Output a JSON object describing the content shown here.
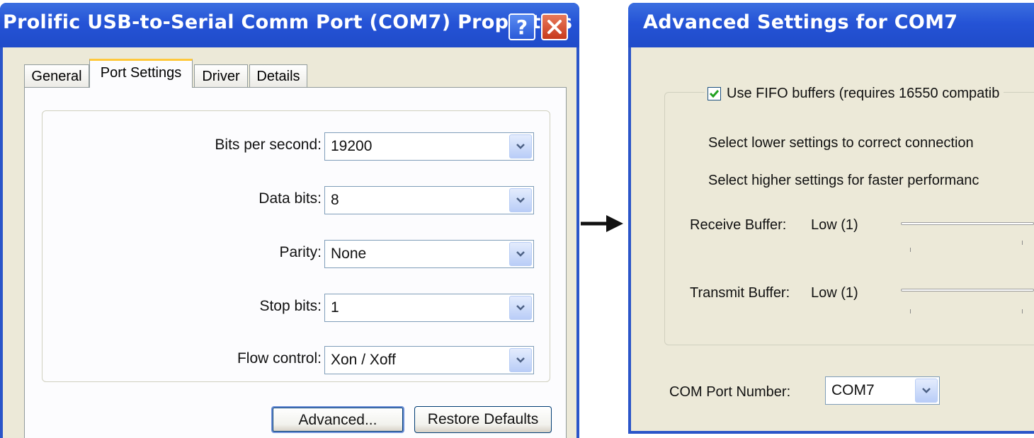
{
  "left_dialog": {
    "title": "Prolific USB-to-Serial Comm Port (COM7) Properties",
    "help_label": "?",
    "tabs": [
      {
        "label": "General"
      },
      {
        "label": "Port Settings"
      },
      {
        "label": "Driver"
      },
      {
        "label": "Details"
      }
    ],
    "fields": {
      "bits": {
        "label": "Bits per second:",
        "value": "19200"
      },
      "data_bits": {
        "label": "Data bits:",
        "value": "8"
      },
      "parity": {
        "label": "Parity:",
        "value": "None"
      },
      "stop_bits": {
        "label": "Stop bits:",
        "value": "1"
      },
      "flow": {
        "label": "Flow control:",
        "value": "Xon / Xoff"
      }
    },
    "buttons": {
      "advanced": "Advanced...",
      "restore": "Restore Defaults"
    }
  },
  "right_dialog": {
    "title": "Advanced Settings for COM7",
    "fifo_label": "Use FIFO buffers (requires 16550 compatib",
    "fifo_checked": true,
    "hint_lower": "Select lower settings to correct connection",
    "hint_higher": "Select higher settings for faster performanc",
    "receive": {
      "label": "Receive Buffer:",
      "value": "Low (1)"
    },
    "transmit": {
      "label": "Transmit Buffer:",
      "value": "Low (1)"
    },
    "com_port": {
      "label": "COM Port Number:",
      "value": "COM7"
    }
  },
  "colors": {
    "title_bar": "#2553d6",
    "dialog_face": "#ece9d8",
    "check_green": "#21a121"
  }
}
